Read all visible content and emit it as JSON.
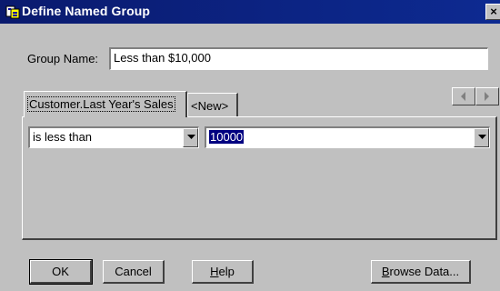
{
  "window": {
    "title": "Define Named Group",
    "close_glyph": "×",
    "title_icon": "group-dialog-icon",
    "titlebar_color": "#0c2484"
  },
  "group_name": {
    "label": "Group Name:",
    "value": "Less than $10,000"
  },
  "tabs": [
    {
      "label": "Customer.Last Year's Sales",
      "active": true
    },
    {
      "label": "<New>",
      "active": false
    }
  ],
  "tab_scroll": {
    "left_icon": "arrow-left-icon",
    "right_icon": "arrow-right-icon"
  },
  "condition": {
    "operator": "is less than",
    "value": "10000"
  },
  "buttons": {
    "ok": "OK",
    "cancel": "Cancel",
    "help_accel": "H",
    "help_rest": "elp",
    "browse_accel": "B",
    "browse_rest": "rowse Data..."
  }
}
